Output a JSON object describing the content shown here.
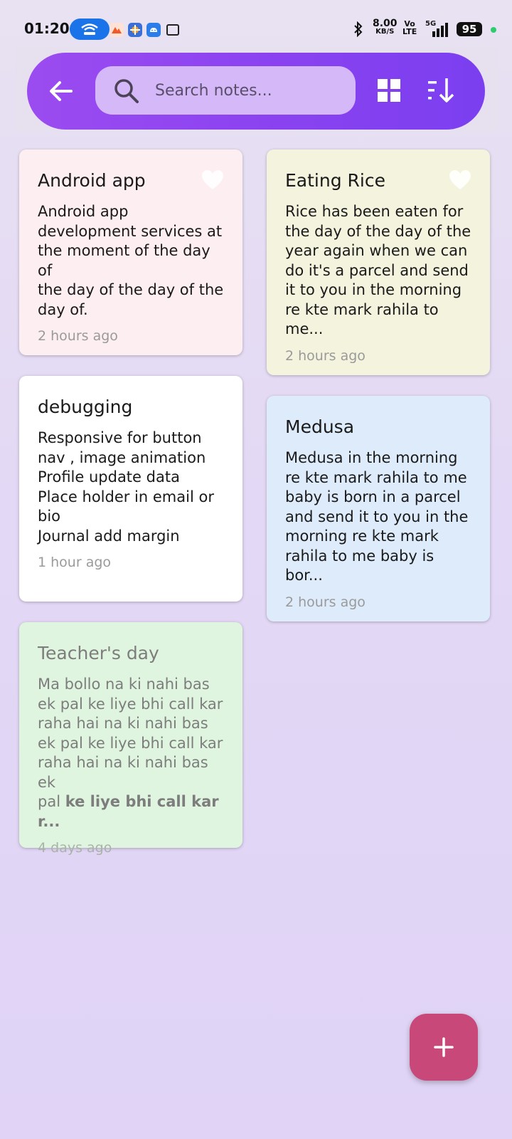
{
  "status_bar": {
    "time": "01:20",
    "speed_value": "8.00",
    "speed_unit": "KB/S",
    "volte_top": "Vo",
    "volte_bottom": "LTE",
    "network": "5G",
    "battery": "95"
  },
  "toolbar": {
    "back_icon": "arrow-left-icon",
    "search_placeholder": "Search notes...",
    "grid_icon": "grid-view-icon",
    "sort_icon": "sort-icon",
    "gradient_colors": [
      "#9b4cf0",
      "#7b3ff0"
    ]
  },
  "notes": [
    {
      "title": "Android app",
      "body": "Android app\ndevelopment services at\nthe moment of the day of\nthe day of the day of the\nday of.",
      "time": "2 hours ago",
      "color": "#fdeef2",
      "favorite_icon": "heart-icon"
    },
    {
      "title": "Eating Rice",
      "body": "Rice has been eaten for\nthe day of the day of the\nyear again when we can\ndo it's a parcel and send\nit to you in the morning\nre kte mark rahila to me...",
      "time": "2 hours ago",
      "color": "#f4f3dd",
      "favorite_icon": "heart-icon"
    },
    {
      "title": "debugging",
      "body": "Responsive for button\nnav , image animation\nProfile update data\nPlace holder in email or\nbio\nJournal add margin",
      "time": "1 hour ago",
      "color": "#ffffff"
    },
    {
      "title": "Medusa",
      "body": "Medusa in the morning\nre kte mark rahila to me\nbaby is born in a parcel\nand send it to you in the\nmorning re kte mark\nrahila to me baby is bor...",
      "time": "2 hours ago",
      "color": "#deebfb"
    },
    {
      "title": "Teacher's day",
      "body_plain": "Ma bollo na ki nahi bas\nek pal ke liye bhi call kar\nraha hai na ki nahi bas\nek pal ke liye bhi call kar\nraha hai na ki nahi bas ek\npal ",
      "body_bold": "ke liye bhi call kar r...",
      "time": "4 days ago",
      "color": "#dff5df"
    }
  ],
  "fab": {
    "icon": "plus-icon",
    "color": "#c8487a"
  }
}
